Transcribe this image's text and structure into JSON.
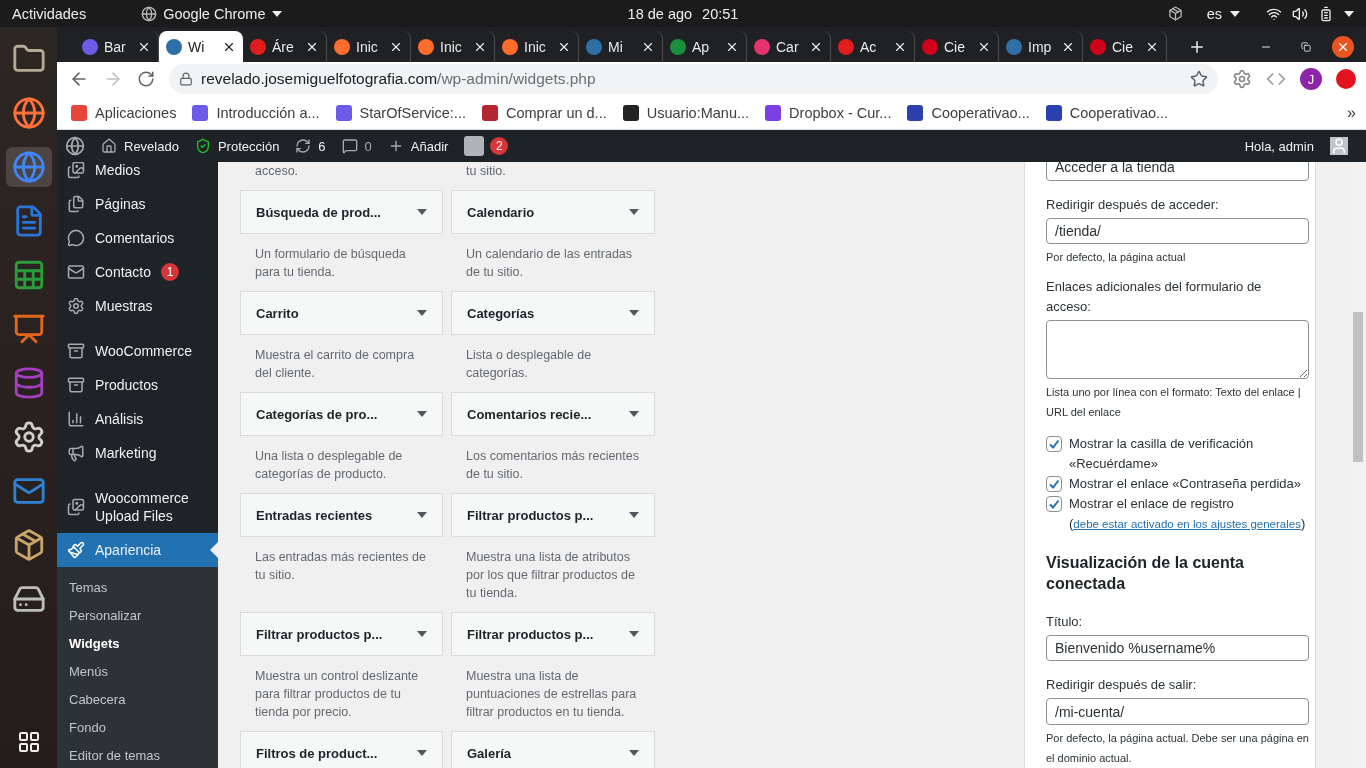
{
  "system_bar": {
    "activities": "Actividades",
    "app": "Google Chrome",
    "date": "18 de ago",
    "time": "20:51",
    "language": "es"
  },
  "tabs": [
    {
      "label": "Bar",
      "selected": false,
      "color": "#6b5ce7"
    },
    {
      "label": "Wi",
      "selected": true,
      "color": "#2f6fa8"
    },
    {
      "label": "Áre",
      "selected": false,
      "color": "#e01e1e"
    },
    {
      "label": "Inic",
      "selected": false,
      "color": "#ff6c2c"
    },
    {
      "label": "Inic",
      "selected": false,
      "color": "#ff6c2c"
    },
    {
      "label": "Inic",
      "selected": false,
      "color": "#ff6c2c"
    },
    {
      "label": "Mi",
      "selected": false,
      "color": "#2f6fa8"
    },
    {
      "label": "Ap",
      "selected": false,
      "color": "#1a8e3c"
    },
    {
      "label": "Car",
      "selected": false,
      "color": "#e5336f"
    },
    {
      "label": "Ac",
      "selected": false,
      "color": "#e01e1e"
    },
    {
      "label": "Cie",
      "selected": false,
      "color": "#d0021b"
    },
    {
      "label": "Imp",
      "selected": false,
      "color": "#2f6fa8"
    },
    {
      "label": "Cie",
      "selected": false,
      "color": "#d0021b"
    }
  ],
  "toolbar": {
    "url_host": "revelado.josemiguelfotografia.com",
    "url_path": "/wp-admin/widgets.php",
    "avatar": "J"
  },
  "bookmarks": [
    {
      "label": "Aplicaciones",
      "color": "#e8453c"
    },
    {
      "label": "Introducción a...",
      "color": "#6b5ce7"
    },
    {
      "label": "StarOfService:...",
      "color": "#6b5ce7"
    },
    {
      "label": "Comprar un d...",
      "color": "#b3262f"
    },
    {
      "label": "Usuario:Manu...",
      "color": "#222222"
    },
    {
      "label": "Dropbox - Cur...",
      "color": "#7b3fe4"
    },
    {
      "label": "Cooperativao...",
      "color": "#2b3fae"
    },
    {
      "label": "Cooperativao...",
      "color": "#2b3fae"
    }
  ],
  "bookmarks_more": "»",
  "admin_bar": {
    "site": "Revelado",
    "security": "Protección",
    "updates": "6",
    "comments": "0",
    "new": "Añadir",
    "seo_count": "2",
    "greeting": "Hola, admin"
  },
  "menu_groups": [
    {
      "items": [
        {
          "label": "Medios"
        },
        {
          "label": "Páginas"
        },
        {
          "label": "Comentarios"
        },
        {
          "label": "Contacto",
          "badge": "1"
        },
        {
          "label": "Muestras"
        }
      ]
    },
    {
      "items": [
        {
          "label": "WooCommerce"
        },
        {
          "label": "Productos"
        },
        {
          "label": "Análisis"
        },
        {
          "label": "Marketing"
        }
      ]
    },
    {
      "items": [
        {
          "label": "Woocommerce Upload Files"
        },
        {
          "label": "Apariencia",
          "selected": true
        }
      ]
    }
  ],
  "submenu": [
    {
      "label": "Temas",
      "selected": false
    },
    {
      "label": "Personalizar",
      "selected": false
    },
    {
      "label": "Widgets",
      "selected": true
    },
    {
      "label": "Menús",
      "selected": false
    },
    {
      "label": "Cabecera",
      "selected": false
    },
    {
      "label": "Fondo",
      "selected": false
    },
    {
      "label": "Editor de temas",
      "selected": false
    }
  ],
  "widgets": [
    {
      "description": "acceso."
    },
    {
      "description": "tu sitio."
    },
    {
      "title": "Búsqueda de prod...",
      "description": "Un formulario de búsqueda para tu tienda."
    },
    {
      "title": "Calendario",
      "description": "Un calendario de las entradas de tu sitio."
    },
    {
      "title": "Carrito",
      "description": "Muestra el carrito de compra del cliente."
    },
    {
      "title": "Categorías",
      "description": "Lista o desplegable de categorías."
    },
    {
      "title": "Categorías de pro...",
      "description": "Una lista o desplegable de categorías de producto."
    },
    {
      "title": "Comentarios recie...",
      "description": "Los comentarios más recientes de tu sitio."
    },
    {
      "title": "Entradas recientes",
      "description": "Las entradas más recientes de tu sitio."
    },
    {
      "title": "Filtrar productos p...",
      "description": "Muestra una lista de atributos por los que filtrar productos de tu tienda."
    },
    {
      "title": "Filtrar productos p...",
      "description": "Muestra un control deslizante para filtrar productos de tu tienda por precio."
    },
    {
      "title": "Filtrar productos p...",
      "description": "Muestra una lista de puntuaciones de estrellas para filtrar productos en tu tienda."
    },
    {
      "title": "Filtros de product..."
    },
    {
      "title": "Galería"
    }
  ],
  "login_widget": {
    "top_field_value": "Acceder a la tienda",
    "redirect_label": "Redirigir después de acceder:",
    "redirect_value": "/tienda/",
    "redirect_help": "Por defecto, la página actual",
    "links_label": "Enlaces adicionales del formulario de acceso:",
    "links_help": "Lista uno por línea con el formato: Texto del enlace | URL del enlace",
    "options": [
      {
        "label": "Mostrar la casilla de verificación «Recuérdame»",
        "checked": true
      },
      {
        "label": "Mostrar el enlace «Contraseña perdida»",
        "checked": true
      },
      {
        "label": "Mostrar el enlace de registro (",
        "link": "debe estar activado en los ajustes generales",
        "after": ")",
        "checked": true
      }
    ],
    "account_heading": "Visualización de la cuenta conectada",
    "title_label": "Título:",
    "title_value": "Bienvenido %username%",
    "logout_label": "Redirigir después de salir:",
    "logout_value": "/mi-cuenta/",
    "logout_help": "Por defecto, la página actual. Debe ser una página en el dominio actual."
  }
}
